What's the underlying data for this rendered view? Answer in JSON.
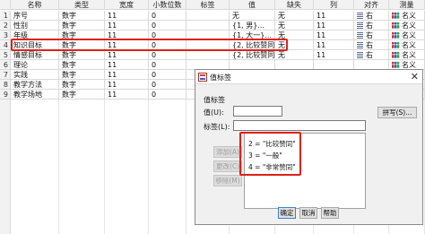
{
  "grid": {
    "columns": [
      "名称",
      "类型",
      "宽度",
      "小数位数",
      "标签",
      "值",
      "缺失",
      "列",
      "对齐",
      "测量"
    ],
    "rows": [
      {
        "num": "1",
        "name": "序号",
        "type": "数字",
        "width": "11",
        "decimals": "0",
        "label": "",
        "values": "无",
        "missing": "无",
        "columns": "11",
        "align": "右",
        "measure": "名义"
      },
      {
        "num": "2",
        "name": "性别",
        "type": "数字",
        "width": "11",
        "decimals": "0",
        "label": "",
        "values": "{1, 男}...",
        "missing": "无",
        "columns": "11",
        "align": "右",
        "measure": "名义"
      },
      {
        "num": "3",
        "name": "年级",
        "type": "数字",
        "width": "11",
        "decimals": "0",
        "label": "",
        "values": "{1, 大一}...",
        "missing": "无",
        "columns": "11",
        "align": "右",
        "measure": "名义"
      },
      {
        "num": "4",
        "name": "知识目标",
        "type": "数字",
        "width": "11",
        "decimals": "0",
        "label": "",
        "values": "{2, 比较赞同}...",
        "missing": "无",
        "columns": "11",
        "align": "右",
        "measure": "名义"
      },
      {
        "num": "5",
        "name": "情感目标",
        "type": "数字",
        "width": "11",
        "decimals": "0",
        "label": "",
        "values": "{2, 比较赞同}...",
        "missing": "无",
        "columns": "11",
        "align": "右",
        "measure": "名义"
      },
      {
        "num": "6",
        "name": "理论",
        "type": "数字",
        "width": "11",
        "decimals": "0",
        "label": "",
        "values": "",
        "missing": "",
        "columns": "",
        "align": "",
        "measure": "名义"
      },
      {
        "num": "7",
        "name": "实践",
        "type": "数字",
        "width": "11",
        "decimals": "0",
        "label": "",
        "values": "",
        "missing": "",
        "columns": "",
        "align": "",
        "measure": "名义"
      },
      {
        "num": "8",
        "name": "教学方法",
        "type": "数字",
        "width": "11",
        "decimals": "0",
        "label": "",
        "values": "",
        "missing": "",
        "columns": "",
        "align": "",
        "measure": "名义"
      },
      {
        "num": "9",
        "name": "教学场地",
        "type": "数字",
        "width": "11",
        "decimals": "0",
        "label": "",
        "values": "",
        "missing": "",
        "columns": "",
        "align": "",
        "measure": "名义"
      }
    ]
  },
  "dialog": {
    "title": "值标签",
    "section": "值标签",
    "value_label": "值(U):",
    "value": "",
    "label_label": "标签(L):",
    "label": "",
    "spelling_button": "拼写(S)...",
    "add_button": "添加(A)",
    "change_button": "更改(C)",
    "remove_button": "移除(M)",
    "list_items": [
      "2 = \"比较赞同\"",
      "3 = \"一般\"",
      "4 = \"非常赞同\""
    ],
    "ok_button": "确定",
    "cancel_button": "取消",
    "help_button": "帮助",
    "close_glyph": "✕"
  },
  "colors": {
    "highlight": "#e0201a",
    "primary_border": "#3c7fd1"
  }
}
